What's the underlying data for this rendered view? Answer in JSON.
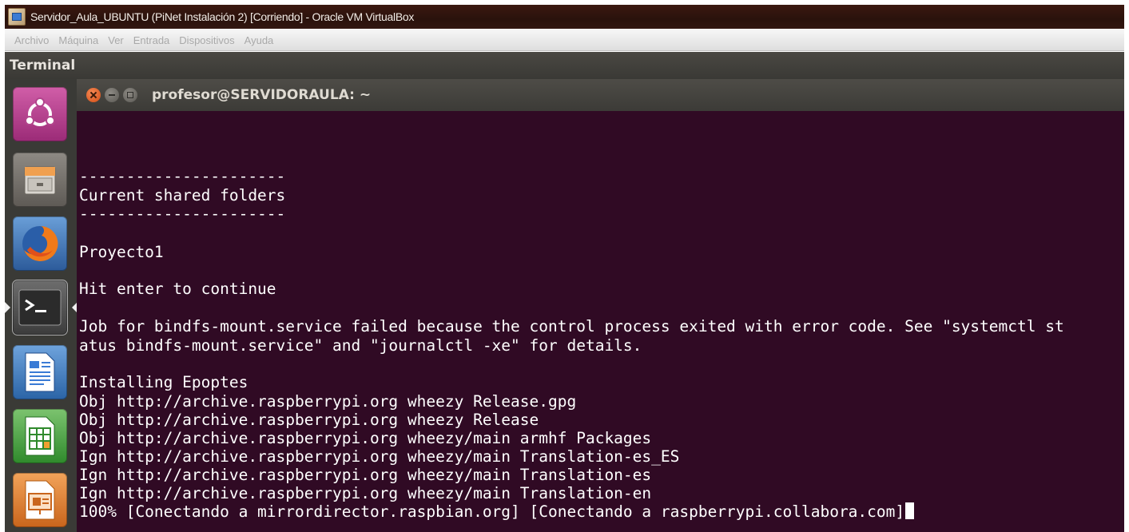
{
  "vbox": {
    "title": "Servidor_Aula_UBUNTU (PiNet Instalación 2) [Corriendo] - Oracle VM VirtualBox",
    "menu": [
      "Archivo",
      "Máquina",
      "Ver",
      "Entrada",
      "Dispositivos",
      "Ayuda"
    ]
  },
  "panel": {
    "title": "Terminal"
  },
  "launcher": {
    "items": [
      "ubuntu-dash",
      "files",
      "firefox",
      "terminal",
      "libreoffice-writer",
      "libreoffice-calc",
      "libreoffice-impress"
    ],
    "active": "terminal"
  },
  "terminal": {
    "title": "profesor@SERVIDORAULA: ~",
    "lines": [
      "----------------------",
      "Current shared folders",
      "----------------------",
      "Proyecto1",
      "Hit enter to continue",
      "Job for bindfs-mount.service failed because the control process exited with error code. See \"systemctl st",
      "atus bindfs-mount.service\" and \"journalctl -xe\" for details.",
      "Installing Epoptes",
      "Obj http://archive.raspberrypi.org wheezy Release.gpg",
      "Obj http://archive.raspberrypi.org wheezy Release",
      "Obj http://archive.raspberrypi.org wheezy/main armhf Packages",
      "Ign http://archive.raspberrypi.org wheezy/main Translation-es_ES",
      "Ign http://archive.raspberrypi.org wheezy/main Translation-es",
      "Ign http://archive.raspberrypi.org wheezy/main Translation-en",
      "100% [Conectando a mirrordirector.raspbian.org] [Conectando a raspberrypi.collabora.com]"
    ]
  },
  "colors": {
    "terminal_bg": "#300a24",
    "terminal_fg": "#ffffff",
    "launcher_bg": "#3a3a36",
    "panel_bg": "#3c3b37",
    "close_button": "#e0561c"
  }
}
